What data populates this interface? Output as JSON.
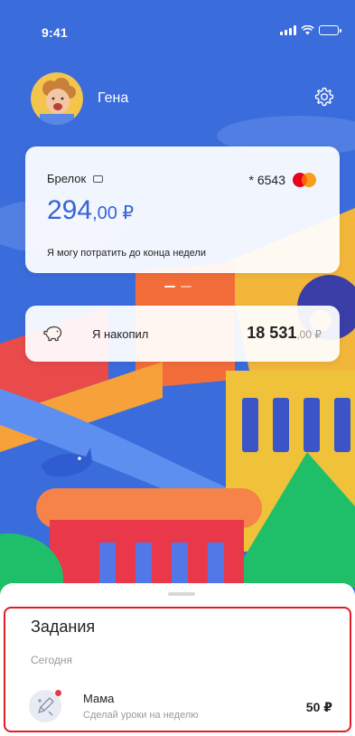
{
  "status_bar": {
    "time": "9:41"
  },
  "profile": {
    "name": "Гена"
  },
  "card": {
    "name": "Брелок",
    "number": "* 6543",
    "balance_main": "294",
    "balance_cents": ",00 ₽",
    "caption": "Я могу потратить до конца недели"
  },
  "savings": {
    "label": "Я накопил",
    "amount_main": "18 531",
    "amount_cents": ",00 ₽"
  },
  "tasks": {
    "title": "Задания",
    "date_group": "Сегодня",
    "items": [
      {
        "title": "Мама",
        "subtitle": "Сделай уроки на неделю",
        "amount": "50 ₽"
      }
    ]
  },
  "colors": {
    "sky": "#3a6cdb",
    "accent_blue": "#3663d8",
    "highlight_red": "#e31b23",
    "badge_red": "#e7384f"
  },
  "icons": {
    "settings": "gear-icon",
    "card_type": "keyfob-icon",
    "payment": "mastercard-icon",
    "savings": "piggy-bank-icon",
    "task": "pencil-icon"
  }
}
